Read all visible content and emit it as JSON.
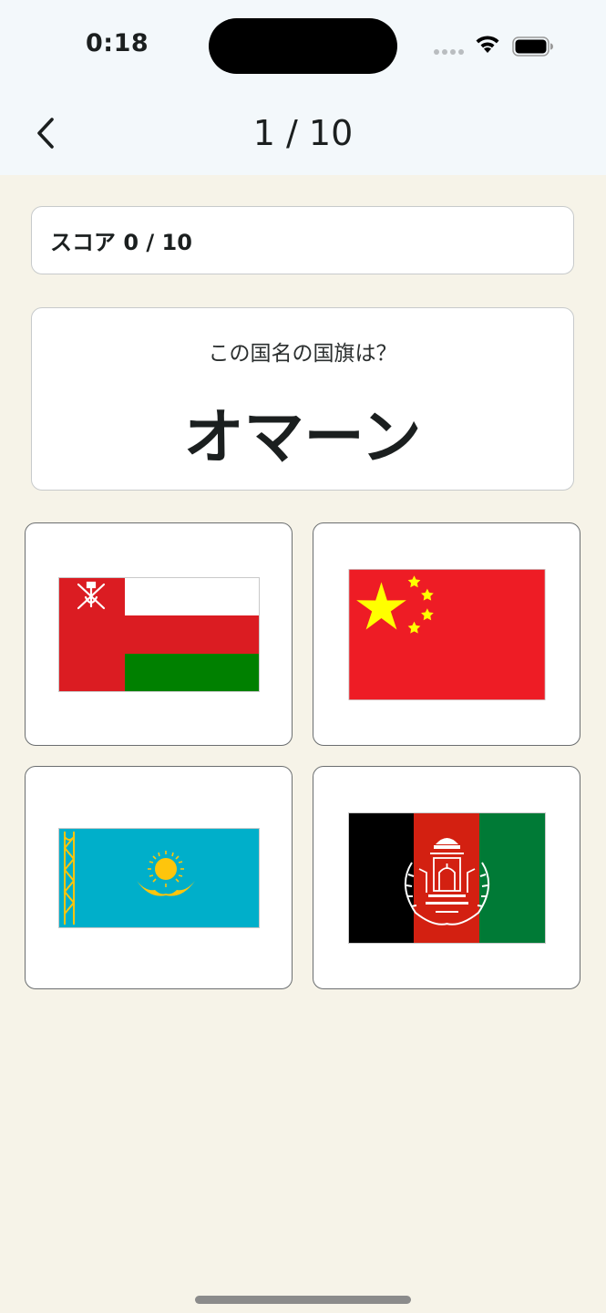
{
  "status_bar": {
    "time": "0:18"
  },
  "nav": {
    "title": "1 / 10",
    "back_icon": "chevron-left-icon"
  },
  "score": {
    "label": "スコア 0 / 10"
  },
  "question": {
    "prompt": "この国名の国旗は？",
    "country": "オマーン"
  },
  "options": [
    {
      "flag": "oman-flag"
    },
    {
      "flag": "china-flag"
    },
    {
      "flag": "kazakhstan-flag"
    },
    {
      "flag": "afghanistan-flag"
    }
  ],
  "colors": {
    "background": "#f6f3e8",
    "header": "#f3f8fb",
    "oman_red": "#db1c22",
    "oman_green": "#008000",
    "china_red": "#ee1c25",
    "china_yellow": "#ffff00",
    "kazakhstan_blue": "#00afca",
    "kazakhstan_gold": "#fec50c",
    "afghanistan_black": "#000000",
    "afghanistan_red": "#d32011",
    "afghanistan_green": "#007a36"
  }
}
